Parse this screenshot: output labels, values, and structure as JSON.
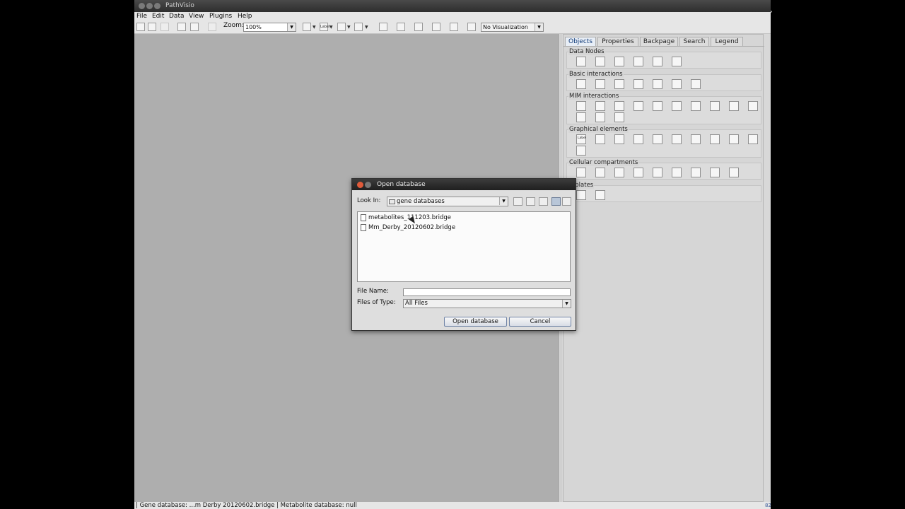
{
  "app": {
    "title": "PathVisio"
  },
  "menu": [
    "File",
    "Edit",
    "Data",
    "View",
    "Plugins",
    "Help"
  ],
  "toolbar": {
    "zoom_label": "Zoom:",
    "zoom_value": "100%",
    "visualization_value": "No Visualization",
    "new_btn_icon": "new-file-icon",
    "open_btn_icon": "open-folder-icon",
    "save_btn_icon": "save-icon",
    "copy_btn_icon": "copy-icon",
    "paste_btn_icon": "paste-icon",
    "undo_btn_icon": "undo-icon",
    "label_btn": "Label"
  },
  "panel": {
    "tabs": [
      "Objects",
      "Properties",
      "Backpage",
      "Search",
      "Legend"
    ],
    "active_tab": "Objects",
    "groups": {
      "data_nodes": "Data Nodes",
      "basic_interactions": "Basic interactions",
      "mim_interactions": "MIM interactions",
      "graphical_elements": "Graphical elements",
      "cellular_compartments": "Cellular compartments",
      "templates": "mplates"
    },
    "data_node_icons": [
      "gene-icon",
      "protein-icon",
      "rna-icon",
      "pathway-icon",
      "metabolite-icon",
      "unknown-icon"
    ],
    "label_icon_text": "Label"
  },
  "status": {
    "text": "| Gene database: ...m Derby 20120602.bridge | Metabolite database: null",
    "right": "82"
  },
  "dialog": {
    "title": "Open database",
    "look_in_label": "Look In:",
    "look_in_value": "gene databases",
    "files": [
      "metabolites_111203.bridge",
      "Mm_Derby_20120602.bridge"
    ],
    "file_name_label": "File Name:",
    "file_name_value": "",
    "files_of_type_label": "Files of Type:",
    "files_of_type_value": "All Files",
    "open_button": "Open database",
    "cancel_button": "Cancel"
  },
  "colors": {
    "canvas": "#aeaeae",
    "panel": "#d6d6d6",
    "active_tab": "#103a78",
    "close_button": "#e05a3a"
  }
}
